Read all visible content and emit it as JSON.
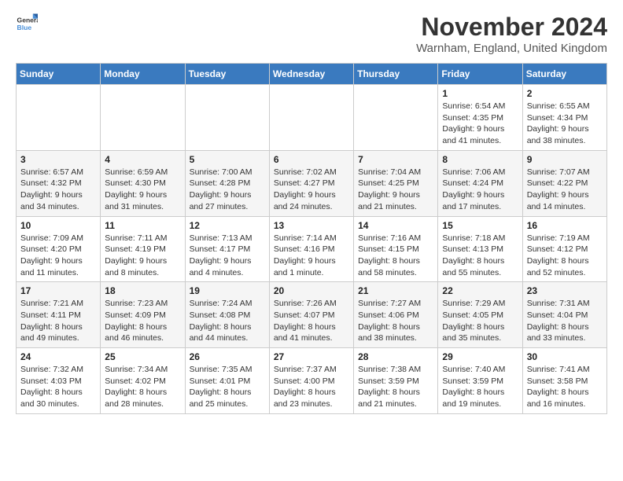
{
  "logo": {
    "text_general": "General",
    "text_blue": "Blue",
    "tagline": "GeneralBlue"
  },
  "title": {
    "month_year": "November 2024",
    "location": "Warnham, England, United Kingdom"
  },
  "days_of_week": [
    "Sunday",
    "Monday",
    "Tuesday",
    "Wednesday",
    "Thursday",
    "Friday",
    "Saturday"
  ],
  "weeks": [
    [
      {
        "day": "",
        "info": ""
      },
      {
        "day": "",
        "info": ""
      },
      {
        "day": "",
        "info": ""
      },
      {
        "day": "",
        "info": ""
      },
      {
        "day": "",
        "info": ""
      },
      {
        "day": "1",
        "info": "Sunrise: 6:54 AM\nSunset: 4:35 PM\nDaylight: 9 hours and 41 minutes."
      },
      {
        "day": "2",
        "info": "Sunrise: 6:55 AM\nSunset: 4:34 PM\nDaylight: 9 hours and 38 minutes."
      }
    ],
    [
      {
        "day": "3",
        "info": "Sunrise: 6:57 AM\nSunset: 4:32 PM\nDaylight: 9 hours and 34 minutes."
      },
      {
        "day": "4",
        "info": "Sunrise: 6:59 AM\nSunset: 4:30 PM\nDaylight: 9 hours and 31 minutes."
      },
      {
        "day": "5",
        "info": "Sunrise: 7:00 AM\nSunset: 4:28 PM\nDaylight: 9 hours and 27 minutes."
      },
      {
        "day": "6",
        "info": "Sunrise: 7:02 AM\nSunset: 4:27 PM\nDaylight: 9 hours and 24 minutes."
      },
      {
        "day": "7",
        "info": "Sunrise: 7:04 AM\nSunset: 4:25 PM\nDaylight: 9 hours and 21 minutes."
      },
      {
        "day": "8",
        "info": "Sunrise: 7:06 AM\nSunset: 4:24 PM\nDaylight: 9 hours and 17 minutes."
      },
      {
        "day": "9",
        "info": "Sunrise: 7:07 AM\nSunset: 4:22 PM\nDaylight: 9 hours and 14 minutes."
      }
    ],
    [
      {
        "day": "10",
        "info": "Sunrise: 7:09 AM\nSunset: 4:20 PM\nDaylight: 9 hours and 11 minutes."
      },
      {
        "day": "11",
        "info": "Sunrise: 7:11 AM\nSunset: 4:19 PM\nDaylight: 9 hours and 8 minutes."
      },
      {
        "day": "12",
        "info": "Sunrise: 7:13 AM\nSunset: 4:17 PM\nDaylight: 9 hours and 4 minutes."
      },
      {
        "day": "13",
        "info": "Sunrise: 7:14 AM\nSunset: 4:16 PM\nDaylight: 9 hours and 1 minute."
      },
      {
        "day": "14",
        "info": "Sunrise: 7:16 AM\nSunset: 4:15 PM\nDaylight: 8 hours and 58 minutes."
      },
      {
        "day": "15",
        "info": "Sunrise: 7:18 AM\nSunset: 4:13 PM\nDaylight: 8 hours and 55 minutes."
      },
      {
        "day": "16",
        "info": "Sunrise: 7:19 AM\nSunset: 4:12 PM\nDaylight: 8 hours and 52 minutes."
      }
    ],
    [
      {
        "day": "17",
        "info": "Sunrise: 7:21 AM\nSunset: 4:11 PM\nDaylight: 8 hours and 49 minutes."
      },
      {
        "day": "18",
        "info": "Sunrise: 7:23 AM\nSunset: 4:09 PM\nDaylight: 8 hours and 46 minutes."
      },
      {
        "day": "19",
        "info": "Sunrise: 7:24 AM\nSunset: 4:08 PM\nDaylight: 8 hours and 44 minutes."
      },
      {
        "day": "20",
        "info": "Sunrise: 7:26 AM\nSunset: 4:07 PM\nDaylight: 8 hours and 41 minutes."
      },
      {
        "day": "21",
        "info": "Sunrise: 7:27 AM\nSunset: 4:06 PM\nDaylight: 8 hours and 38 minutes."
      },
      {
        "day": "22",
        "info": "Sunrise: 7:29 AM\nSunset: 4:05 PM\nDaylight: 8 hours and 35 minutes."
      },
      {
        "day": "23",
        "info": "Sunrise: 7:31 AM\nSunset: 4:04 PM\nDaylight: 8 hours and 33 minutes."
      }
    ],
    [
      {
        "day": "24",
        "info": "Sunrise: 7:32 AM\nSunset: 4:03 PM\nDaylight: 8 hours and 30 minutes."
      },
      {
        "day": "25",
        "info": "Sunrise: 7:34 AM\nSunset: 4:02 PM\nDaylight: 8 hours and 28 minutes."
      },
      {
        "day": "26",
        "info": "Sunrise: 7:35 AM\nSunset: 4:01 PM\nDaylight: 8 hours and 25 minutes."
      },
      {
        "day": "27",
        "info": "Sunrise: 7:37 AM\nSunset: 4:00 PM\nDaylight: 8 hours and 23 minutes."
      },
      {
        "day": "28",
        "info": "Sunrise: 7:38 AM\nSunset: 3:59 PM\nDaylight: 8 hours and 21 minutes."
      },
      {
        "day": "29",
        "info": "Sunrise: 7:40 AM\nSunset: 3:59 PM\nDaylight: 8 hours and 19 minutes."
      },
      {
        "day": "30",
        "info": "Sunrise: 7:41 AM\nSunset: 3:58 PM\nDaylight: 8 hours and 16 minutes."
      }
    ]
  ]
}
